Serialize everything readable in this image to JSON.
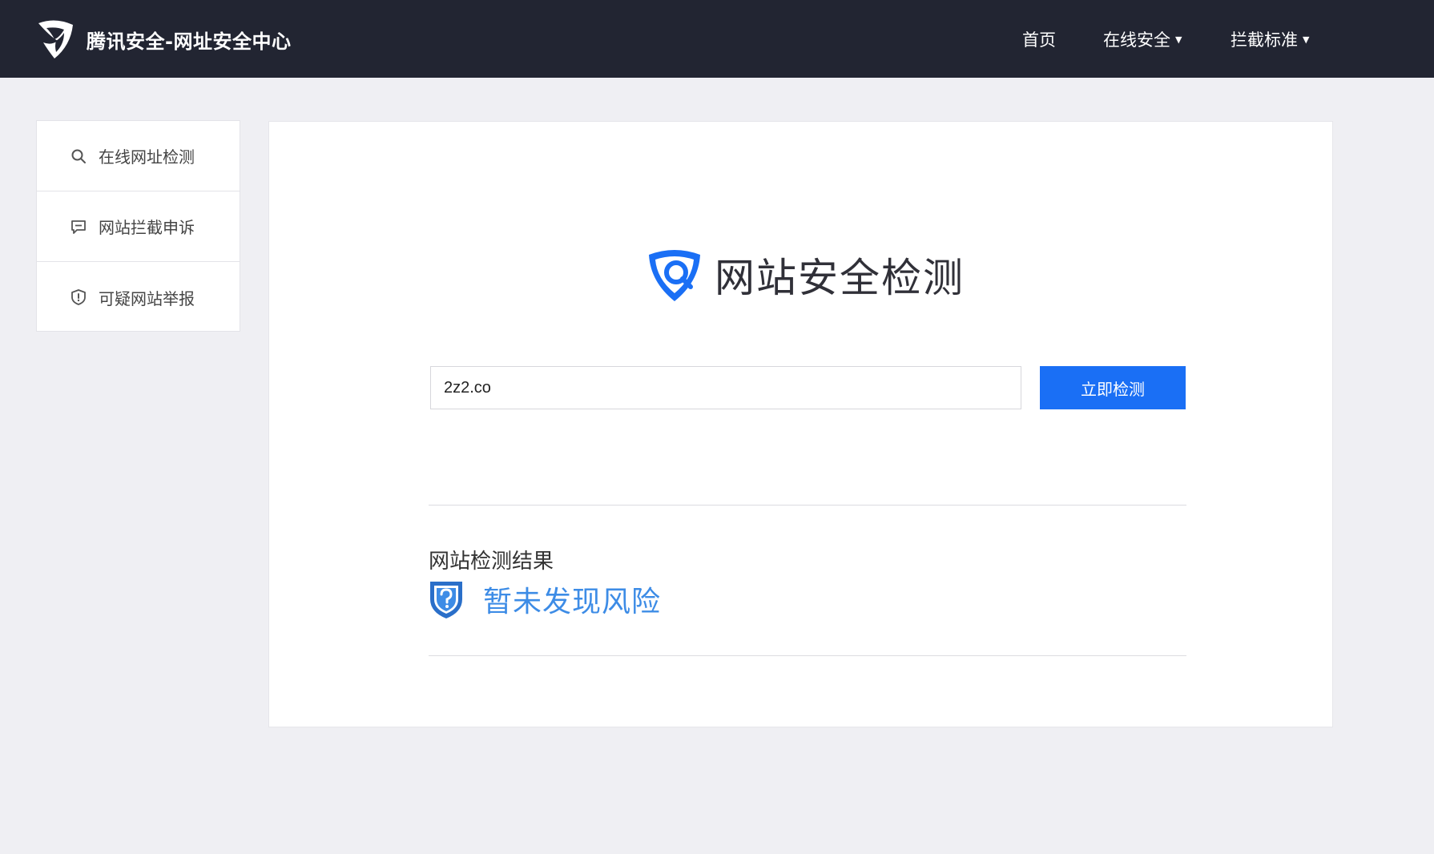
{
  "header": {
    "brand_title": "腾讯安全-网址安全中心",
    "nav": [
      {
        "label": "首页",
        "has_dropdown": false
      },
      {
        "label": "在线安全",
        "has_dropdown": true
      },
      {
        "label": "拦截标准",
        "has_dropdown": true
      }
    ],
    "caret": "▼"
  },
  "sidebar": {
    "items": [
      {
        "label": "在线网址检测",
        "icon": "search-icon"
      },
      {
        "label": "网站拦截申诉",
        "icon": "message-icon"
      },
      {
        "label": "可疑网站举报",
        "icon": "shield-alert-icon"
      }
    ]
  },
  "main": {
    "hero_title": "网站安全检测",
    "search": {
      "value": "2z2.co",
      "button_label": "立即检测"
    },
    "result": {
      "label": "网站检测结果",
      "status": "暂未发现风险"
    }
  },
  "colors": {
    "topbar": "#222532",
    "page_bg": "#efeff3",
    "accent": "#1a6ff5",
    "result_text": "#3d8ce6"
  }
}
